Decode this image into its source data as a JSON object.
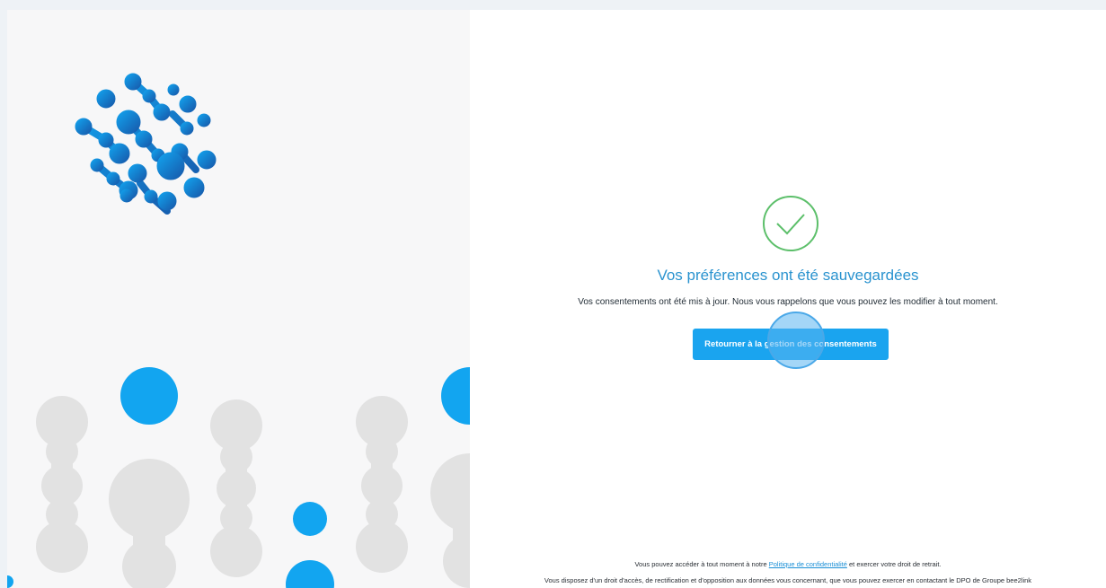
{
  "confirmation": {
    "title": "Vos préférences ont été sauvegardées",
    "message": "Vos consentements ont été mis à jour. Nous vous rappelons que vous pouvez les modifier à tout moment.",
    "button_label": "Retourner à la gestion des consentements"
  },
  "footer": {
    "line1_before": "Vous pouvez accéder à tout moment à notre ",
    "privacy_link": "Politique de confidentialité",
    "line1_after": " et exercer votre droit de retrait.",
    "line2": "Vous disposez d'un droit d'accès, de rectification et d'opposition aux données vous concernant, que vous pouvez exercer en contactant le DPO de Groupe bee2link"
  },
  "colors": {
    "accent": "#1aa4ef",
    "title": "#2a93cf",
    "success": "#5cbf6a",
    "decor_grey": "#e2e2e2",
    "logo_dark": "#1565b5"
  },
  "icons": [
    "brand-logo-icon",
    "success-check-icon"
  ]
}
